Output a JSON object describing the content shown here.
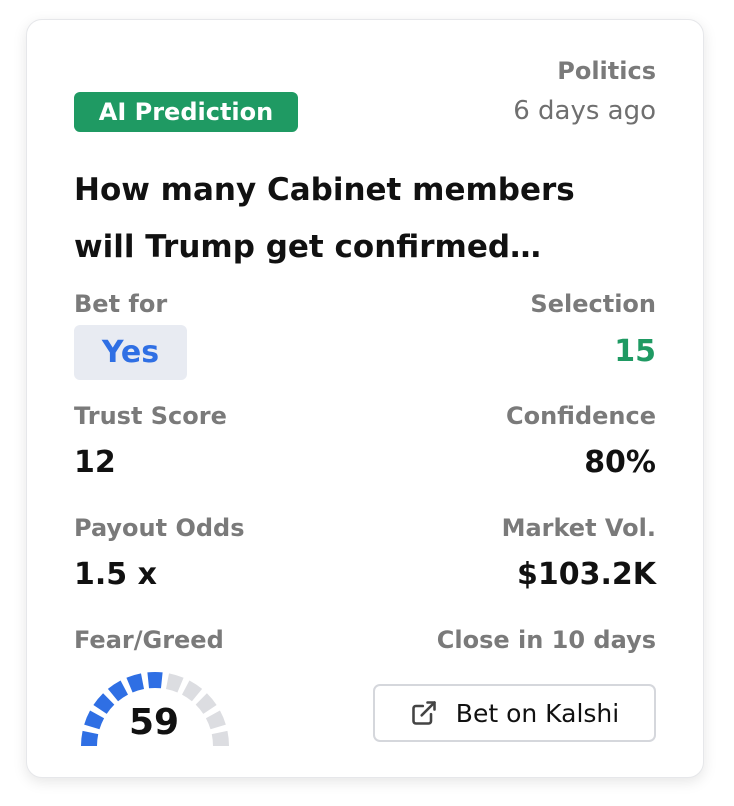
{
  "card": {
    "category": "Politics",
    "time_ago": "6 days ago",
    "badge": "AI Prediction",
    "title_line1": "How many Cabinet members",
    "title_line2": "will Trump get confirmed…"
  },
  "stats": {
    "bet_for_label": "Bet for",
    "bet_for_value": "Yes",
    "selection_label": "Selection",
    "selection_value": "15",
    "trust_label": "Trust Score",
    "trust_value": "12",
    "confidence_label": "Confidence",
    "confidence_value": "80%",
    "payout_label": "Payout Odds",
    "payout_value": "1.5 x",
    "volume_label": "Market Vol.",
    "volume_value": "$103.2K",
    "fear_label": "Fear/Greed",
    "close_label": "Close in 10 days"
  },
  "gauge": {
    "value": "59",
    "fraction": 0.59,
    "filled_color": "#2f6fe4",
    "empty_color": "#dcdde1"
  },
  "actions": {
    "bet_button_label": "Bet on Kalshi",
    "bet_button_icon": "external-link-icon"
  },
  "colors": {
    "badge_bg": "#1f9a63",
    "selection_green": "#1f9a63",
    "yes_blue": "#2f6fe4"
  }
}
